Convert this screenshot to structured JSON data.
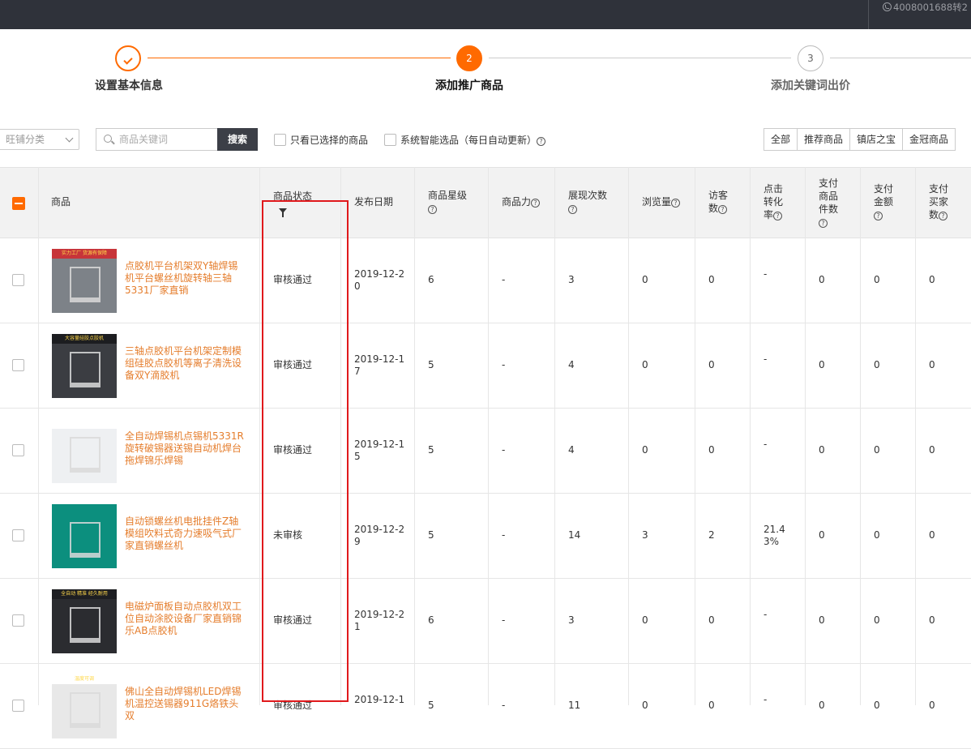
{
  "topbar": {
    "phone": "4008001688转2"
  },
  "steps": [
    {
      "num": "1",
      "label": "设置基本信息",
      "state": "done"
    },
    {
      "num": "2",
      "label": "添加推广商品",
      "state": "active"
    },
    {
      "num": "3",
      "label": "添加关键词出价",
      "state": "pending"
    }
  ],
  "filters": {
    "category_placeholder": "旺铺分类",
    "search_placeholder": "商品关键词",
    "search_button": "搜索",
    "only_selected": "只看已选择的商品",
    "smart_select": "系统智能选品（每日自动更新）",
    "segments": [
      "全部",
      "推荐商品",
      "镇店之宝",
      "金冠商品"
    ]
  },
  "table": {
    "headers": {
      "product": "商品",
      "status": "商品状态",
      "date": "发布日期",
      "stars": "商品星级",
      "power": "商品力",
      "impressions": "展现次数",
      "views": "浏览量",
      "visitors_1": "访客",
      "visitors_2": "数",
      "conv_1": "点击",
      "conv_2": "转化",
      "conv_3": "率",
      "pay_items_1": "支付",
      "pay_items_2": "商品",
      "pay_items_3": "件数",
      "pay_amount_1": "支付",
      "pay_amount_2": "金额",
      "pay_buyers_1": "支付",
      "pay_buyers_2": "买家",
      "pay_buyers_3": "数"
    },
    "rows": [
      {
        "name": "点胶机平台机架双Y轴焊锡机平台螺丝机旋转轴三轴5331厂家直销",
        "status": "审核通过",
        "date": "2019-12-20",
        "stars": "6",
        "power": "-",
        "impressions": "3",
        "views": "0",
        "visitors": "0",
        "conv": "-",
        "pay_items": "0",
        "pay_amount": "0",
        "pay_buyers": "0",
        "thumb_caption": "实力工厂 货源有保障"
      },
      {
        "name": "三轴点胶机平台机架定制模组硅胶点胶机等离子清洗设备双Y滴胶机",
        "status": "审核通过",
        "date": "2019-12-17",
        "stars": "5",
        "power": "-",
        "impressions": "4",
        "views": "0",
        "visitors": "0",
        "conv": "-",
        "pay_items": "0",
        "pay_amount": "0",
        "pay_buyers": "0",
        "thumb_caption": "大容量硅胶点胶机"
      },
      {
        "name": "全自动焊锡机点锡机5331R旋转破锡器送锡自动机焊台拖焊锦乐焊锡",
        "status": "审核通过",
        "date": "2019-12-15",
        "stars": "5",
        "power": "-",
        "impressions": "4",
        "views": "0",
        "visitors": "0",
        "conv": "-",
        "pay_items": "0",
        "pay_amount": "0",
        "pay_buyers": "0",
        "thumb_caption": ""
      },
      {
        "name": "自动锁螺丝机电批挂件Z轴模组吹料式奇力速吸气式厂家直销螺丝机",
        "status": "未审核",
        "date": "2019-12-29",
        "stars": "5",
        "power": "-",
        "impressions": "14",
        "views": "3",
        "visitors": "2",
        "conv": "21.43%",
        "pay_items": "0",
        "pay_amount": "0",
        "pay_buyers": "0",
        "thumb_caption": ""
      },
      {
        "name": "电磁炉面板自动点胶机双工位自动涂胶设备厂家直销锦乐AB点胶机",
        "status": "审核通过",
        "date": "2019-12-21",
        "stars": "6",
        "power": "-",
        "impressions": "3",
        "views": "0",
        "visitors": "0",
        "conv": "-",
        "pay_items": "0",
        "pay_amount": "0",
        "pay_buyers": "0",
        "thumb_caption": "全自动 精准 经久耐用"
      },
      {
        "name": "佛山全自动焊锡机LED焊锡机温控送锡器911G烙铁头双",
        "status": "审核通过",
        "date": "2019-12-1",
        "stars": "5",
        "power": "-",
        "impressions": "11",
        "views": "0",
        "visitors": "0",
        "conv": "-",
        "pay_items": "0",
        "pay_amount": "0",
        "pay_buyers": "0",
        "thumb_caption": "温度可调"
      }
    ]
  },
  "colors": {
    "accent": "#ff6a00",
    "product_link": "#e57d2c",
    "highlight_box": "#e0191c",
    "topbar": "#2f323a"
  }
}
